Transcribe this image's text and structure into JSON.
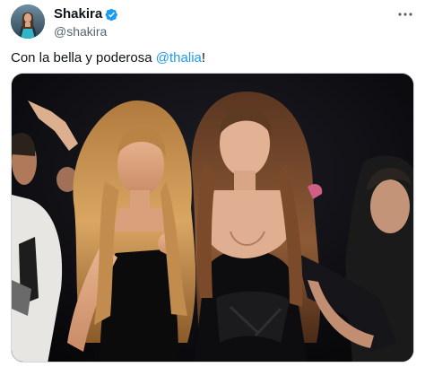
{
  "author": {
    "display_name": "Shakira",
    "handle": "@shakira",
    "verified": true,
    "avatar_icon": "profile-photo"
  },
  "tweet": {
    "text_before": "Con la bella y poderosa ",
    "mention": "@thalia",
    "text_after": "!"
  },
  "media": {
    "kind": "photo"
  },
  "colors": {
    "link": "#1d9bf0",
    "verified": "#1d9bf0",
    "secondary_text": "#536471"
  },
  "icons": {
    "more": "more-horizontal-icon",
    "verified": "verified-badge-icon"
  }
}
